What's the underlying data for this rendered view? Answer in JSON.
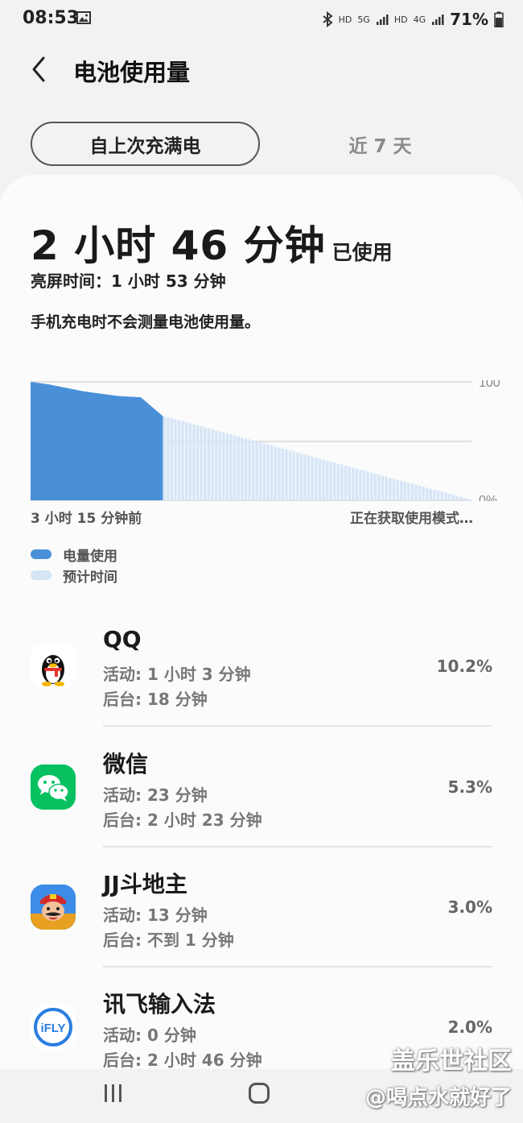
{
  "status_bar": {
    "time": "08:53",
    "indicators": [
      "bluetooth-icon",
      "HD",
      "5G",
      "signal-icon",
      "HD",
      "4G",
      "signal-icon"
    ],
    "hd1": "HD",
    "net1": "5G",
    "hd2": "HD",
    "net2": "4G",
    "battery_percent": "71%"
  },
  "header": {
    "title": "电池使用量"
  },
  "tabs": [
    {
      "label": "自上次充满电",
      "selected": true
    },
    {
      "label": "近 7 天",
      "selected": false
    }
  ],
  "summary": {
    "usage_time": "2 小时 46 分钟",
    "usage_suffix": "已使用",
    "screen_on_time": "亮屏时间：1 小时 53 分钟",
    "note": "手机充电时不会测量电池使用量。"
  },
  "chart": {
    "y_top_label": "100",
    "y_bottom_label": "0%",
    "x_start_label": "3 小时 15 分钟前",
    "x_end_label": "正在获取使用模式…",
    "legend": [
      {
        "label": "电量使用",
        "color": "#4a90d9"
      },
      {
        "label": "预计时间",
        "color": "#d6e6f7"
      }
    ]
  },
  "chart_data": {
    "type": "area",
    "ylim": [
      0,
      100
    ],
    "series": [
      {
        "name": "电量使用",
        "x": [
          0,
          0.04,
          0.08,
          0.12,
          0.16,
          0.2,
          0.25,
          0.3
        ],
        "values": [
          100,
          98,
          95,
          92,
          90,
          88,
          87,
          71
        ]
      },
      {
        "name": "预计时间",
        "x": [
          0.3,
          1.0
        ],
        "values": [
          71,
          0
        ]
      }
    ],
    "x_labels": [
      "3 小时 15 分钟前",
      "正在获取使用模式…"
    ]
  },
  "apps": [
    {
      "name": "QQ",
      "active": "活动: 1 小时 3 分钟",
      "background": "后台: 18 分钟",
      "percent": "10.2%",
      "icon": "qq-icon"
    },
    {
      "name": "微信",
      "active": "活动: 23 分钟",
      "background": "后台: 2 小时 23 分钟",
      "percent": "5.3%",
      "icon": "wechat-icon"
    },
    {
      "name": "JJ斗地主",
      "active": "活动: 13 分钟",
      "background": "后台: 不到 1 分钟",
      "percent": "3.0%",
      "icon": "jj-doudizhu-icon"
    },
    {
      "name": "讯飞输入法",
      "active": "活动: 0 分钟",
      "background": "后台: 2 小时 46 分钟",
      "percent": "2.0%",
      "icon": "ifly-icon"
    }
  ],
  "icon_text": {
    "ifly": "iFLY"
  },
  "watermark": {
    "line1": "盖乐世社区",
    "line2": "@喝点水就好了"
  },
  "colors": {
    "accent_blue": "#4a90d9",
    "projection_blue": "#d6e6f7"
  }
}
